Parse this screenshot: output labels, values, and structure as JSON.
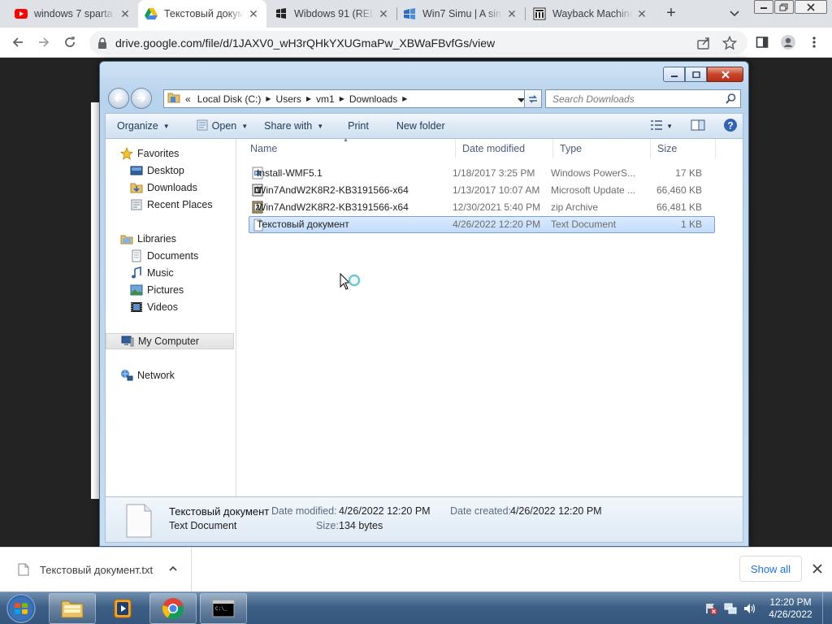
{
  "browser": {
    "tabs": [
      {
        "title": "windows 7 sparta",
        "icon": "youtube-icon",
        "active": false
      },
      {
        "title": "Текстовый докум",
        "icon": "google-drive-icon",
        "active": true
      },
      {
        "title": "Wibdows 91 (REL",
        "icon": "wibdows-icon",
        "active": false
      },
      {
        "title": "Win7 Simu | A sim",
        "icon": "win7simu-icon",
        "active": false
      },
      {
        "title": "Wayback Machine",
        "icon": "wayback-icon",
        "active": false
      }
    ],
    "url": "drive.google.com/file/d/1JAXV0_wH3rQHkYXUGmaPw_XBWaFBvfGs/view"
  },
  "explorer": {
    "breadcrumb": [
      "Local Disk (C:)",
      "Users",
      "vm1",
      "Downloads"
    ],
    "breadcrumb_prefix": "«",
    "search_placeholder": "Search Downloads",
    "commands": [
      "Organize",
      "Open",
      "Share with",
      "Print",
      "New folder"
    ],
    "nav": {
      "favorites": {
        "label": "Favorites",
        "items": [
          "Desktop",
          "Downloads",
          "Recent Places"
        ]
      },
      "libraries": {
        "label": "Libraries",
        "items": [
          "Documents",
          "Music",
          "Pictures",
          "Videos"
        ]
      },
      "computer": "My Computer",
      "network": "Network"
    },
    "columns": [
      "Name",
      "Date modified",
      "Type",
      "Size"
    ],
    "files": [
      {
        "name": "Install-WMF5.1",
        "date": "1/18/2017 3:25 PM",
        "type": "Windows PowerS...",
        "size": "17 KB",
        "icon": "powershell-script-icon"
      },
      {
        "name": "Win7AndW2K8R2-KB3191566-x64",
        "date": "1/13/2017 10:07 AM",
        "type": "Microsoft Update ...",
        "size": "66,460 KB",
        "icon": "msu-package-icon"
      },
      {
        "name": "Win7AndW2K8R2-KB3191566-x64",
        "date": "12/30/2021 5:40 PM",
        "type": "zip Archive",
        "size": "66,481 KB",
        "icon": "zip-archive-icon"
      },
      {
        "name": "Текстовый документ",
        "date": "4/26/2022 12:20 PM",
        "type": "Text Document",
        "size": "1 KB",
        "icon": "text-document-icon",
        "selected": true
      }
    ],
    "details": {
      "name": "Текстовый документ",
      "type": "Text Document",
      "date_modified_label": "Date modified:",
      "date_modified": "4/26/2022 12:20 PM",
      "date_created_label": "Date created:",
      "date_created": "4/26/2022 12:20 PM",
      "size_label": "Size:",
      "size": "134 bytes"
    }
  },
  "downloads_bar": {
    "filename": "Текстовый документ.txt",
    "show_all": "Show all"
  },
  "taskbar": {
    "time": "12:20 PM",
    "date": "4/26/2022"
  },
  "colors": {
    "chrome_tabstrip": "#dee1e6",
    "selection": "#c1dbfc",
    "taskbar": "#3d5f86",
    "link_blue": "#1a73e8"
  }
}
